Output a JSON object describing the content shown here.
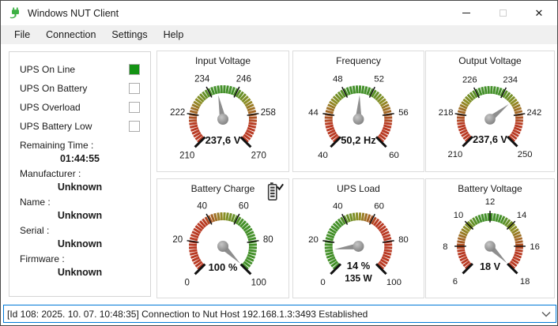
{
  "window": {
    "title": "Windows NUT Client",
    "controls": {
      "close_glyph": "✕"
    }
  },
  "menu": {
    "items": [
      "File",
      "Connection",
      "Settings",
      "Help"
    ]
  },
  "status_panel": {
    "on_color": "#149314",
    "indicators": [
      {
        "label": "UPS On Line",
        "on": true
      },
      {
        "label": "UPS On Battery",
        "on": false
      },
      {
        "label": "UPS Overload",
        "on": false
      },
      {
        "label": "UPS Battery Low",
        "on": false
      }
    ],
    "fields": [
      {
        "label": "Remaining Time :",
        "value": "01:44:55"
      },
      {
        "label": "Manufacturer :",
        "value": "Unknown"
      },
      {
        "label": "Name :",
        "value": "Unknown"
      },
      {
        "label": "Serial :",
        "value": "Unknown"
      },
      {
        "label": "Firmware :",
        "value": "Unknown"
      }
    ]
  },
  "gauge_style": {
    "red": "#b93b24",
    "olive": "#8f8f26",
    "green": "#44902a",
    "tick": "#111111",
    "needle": "#8e8e8e"
  },
  "gauges": [
    {
      "title": "Input Voltage",
      "min": 210,
      "max": 270,
      "tick_labels": [
        210,
        222,
        234,
        246,
        258,
        270
      ],
      "value": 237.6,
      "display": "237,6 V",
      "scheme": "ends-red"
    },
    {
      "title": "Frequency",
      "min": 40,
      "max": 60,
      "tick_labels": [
        40,
        44,
        48,
        52,
        56,
        60
      ],
      "value": 50.2,
      "display": "50,2 Hz",
      "scheme": "ends-red"
    },
    {
      "title": "Output Voltage",
      "min": 210,
      "max": 250,
      "tick_labels": [
        210,
        218,
        226,
        234,
        242,
        250
      ],
      "value": 237.6,
      "display": "237,6 V",
      "scheme": "ends-red"
    },
    {
      "title": "Battery Charge",
      "min": 0,
      "max": 100,
      "tick_labels": [
        0,
        20,
        40,
        60,
        80,
        100
      ],
      "value": 100,
      "display": "100 %",
      "scheme": "low-red",
      "icon": "battery-check-icon"
    },
    {
      "title": "UPS Load",
      "min": 0,
      "max": 100,
      "tick_labels": [
        0,
        20,
        40,
        60,
        80,
        100
      ],
      "value": 14,
      "display": "14 %",
      "display2": "135 W",
      "scheme": "high-red"
    },
    {
      "title": "Battery Voltage",
      "min": 6,
      "max": 18,
      "tick_labels": [
        6,
        8,
        10,
        12,
        14,
        16,
        18
      ],
      "value": 18,
      "display": "18 V",
      "scheme": "ends-red"
    }
  ],
  "statusbar": {
    "message": "[Id 108: 2025. 10. 07. 10:48:35] Connection to Nut Host 192.168.1.3:3493 Established"
  }
}
